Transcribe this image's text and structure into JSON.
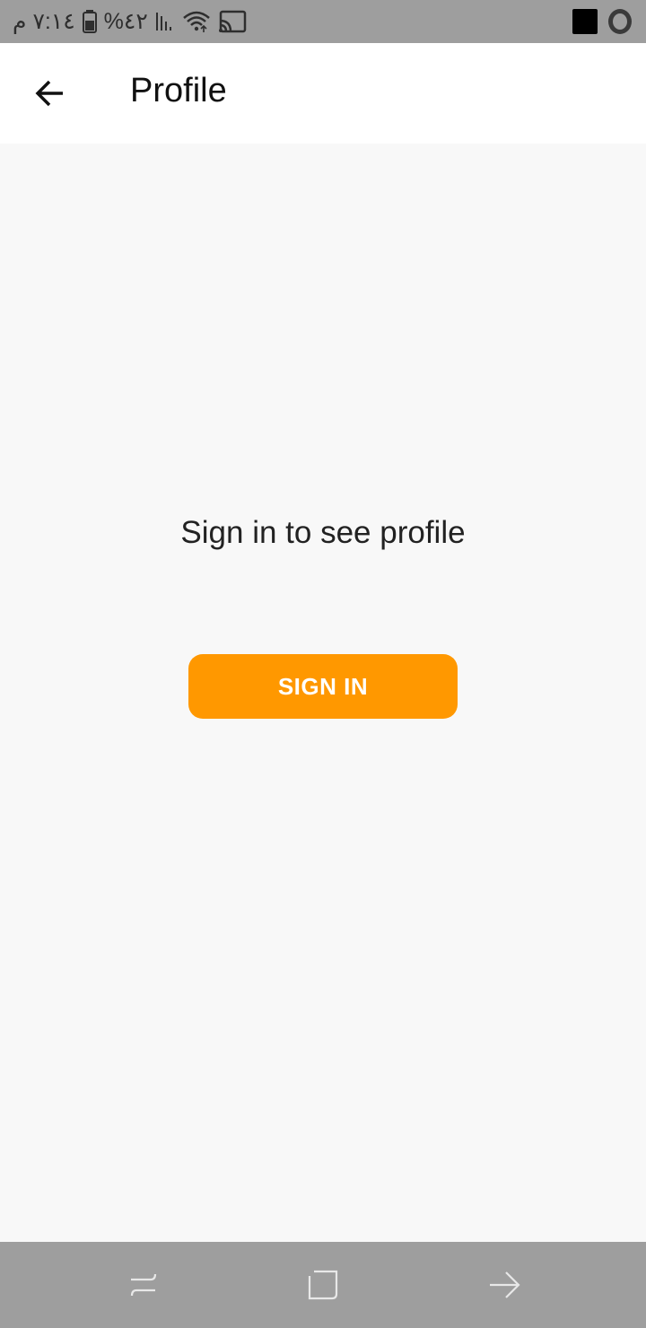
{
  "status_bar": {
    "time": "٧:١٤ م",
    "battery": "%٤٢",
    "icons": [
      "battery-icon",
      "signal-icon",
      "wifi-icon",
      "cast-icon",
      "notification-square-icon",
      "opera-icon"
    ]
  },
  "app_bar": {
    "title": "Profile",
    "back_icon": "arrow-back-icon"
  },
  "main": {
    "message": "Sign in to see profile",
    "sign_in_label": "SIGN IN",
    "accent_color": "#ff9800"
  },
  "nav_bar": {
    "buttons": [
      "recent-apps-icon",
      "home-icon",
      "back-icon"
    ]
  }
}
